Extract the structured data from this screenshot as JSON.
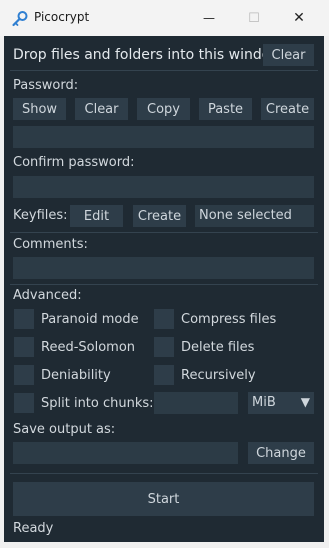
{
  "window": {
    "title": "Picocrypt",
    "minimize": "—",
    "maximize": "☐",
    "close": "✕"
  },
  "drop": {
    "label": "Drop files and folders into this window",
    "clear": "Clear"
  },
  "password": {
    "label": "Password:",
    "buttons": [
      "Show",
      "Clear",
      "Copy",
      "Paste",
      "Create"
    ],
    "value": ""
  },
  "confirm": {
    "label": "Confirm password:",
    "value": ""
  },
  "keyfiles": {
    "label": "Keyfiles:",
    "edit": "Edit",
    "create": "Create",
    "status": "None selected"
  },
  "comments": {
    "label": "Comments:",
    "value": ""
  },
  "advanced": {
    "label": "Advanced:",
    "options": {
      "paranoid": "Paranoid mode",
      "compress": "Compress files",
      "reed": "Reed-Solomon",
      "delete": "Delete files",
      "deniability": "Deniability",
      "recursively": "Recursively",
      "split": "Split into chunks:"
    },
    "chunk_size": "",
    "chunk_unit": "MiB",
    "dropdown_arrow": "▼"
  },
  "output": {
    "label": "Save output as:",
    "value": "",
    "change": "Change"
  },
  "start": "Start",
  "status": "Ready"
}
